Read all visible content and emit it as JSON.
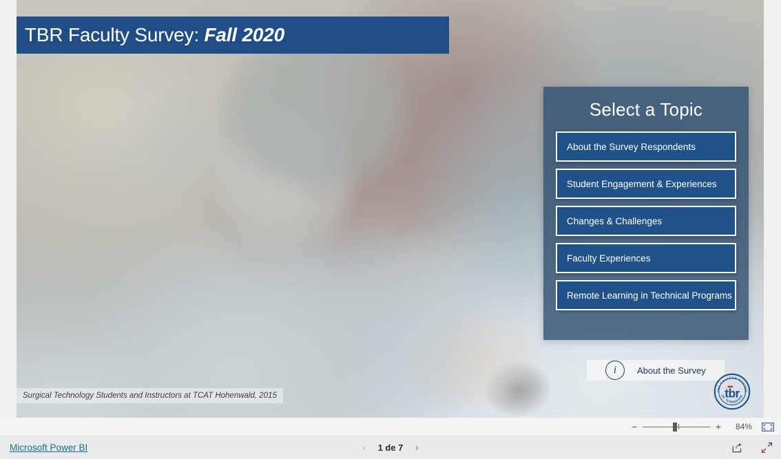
{
  "report": {
    "title_main": "TBR Faculty Survey: ",
    "title_italic": "Fall 2020",
    "photo_caption": "Surgical Technology Students and Instructors at TCAT Hohenwald, 2015"
  },
  "topic_panel": {
    "heading": "Select a Topic",
    "buttons": [
      {
        "label": "About the Survey Respondents"
      },
      {
        "label": "Student Engagement & Experiences"
      },
      {
        "label": "Changes & Challenges"
      },
      {
        "label": "Faculty Experiences"
      },
      {
        "label": "Remote Learning in Technical Programs"
      }
    ]
  },
  "about_survey": {
    "label": "About the Survey",
    "icon": "info-icon"
  },
  "logo": {
    "wordmark": "tbr",
    "arc_top": "THE COLLEGE SYSTEM",
    "arc_bottom": "OF TENNESSEE"
  },
  "zoom_toolbar": {
    "minus": "−",
    "plus": "+",
    "percent": "84%",
    "fit_icon": "fit-to-page-icon"
  },
  "footer": {
    "powerbi_link": "Microsoft Power BI",
    "prev_icon": "‹",
    "next_icon": "›",
    "page_indicator": "1 de 7",
    "share_icon": "share-icon",
    "fullscreen_icon": "fullscreen-icon"
  },
  "colors": {
    "header_blue": "#1f4e87",
    "button_blue": "#1f5289",
    "panel_overlay": "#2f4f70",
    "link_teal": "#14748a",
    "logo_blue": "#1f5289",
    "logo_red": "#c8342c"
  }
}
